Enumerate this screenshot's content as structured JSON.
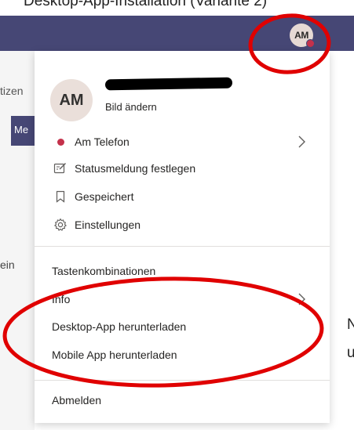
{
  "caption": {
    "top": "Desktop-App-Installation (Variante 2)"
  },
  "topbar": {
    "avatar_initials": "AM"
  },
  "background": {
    "left_fragment_1": "tizen",
    "left_fragment_2": "Me",
    "left_fragment_3": "ein",
    "right_fragment_1": "N",
    "right_fragment_2": "u"
  },
  "profile": {
    "initials": "AM",
    "change_picture": "Bild ändern"
  },
  "menu": {
    "status": "Am Telefon",
    "status_message": "Statusmeldung festlegen",
    "saved": "Gespeichert",
    "settings": "Einstellungen",
    "shortcuts": "Tastenkombinationen",
    "info": "Info",
    "desktop_app": "Desktop-App herunterladen",
    "mobile_app": "Mobile App herunterladen",
    "sign_out": "Abmelden"
  },
  "colors": {
    "header": "#464775",
    "status_busy": "#c4314b",
    "annotation": "#e00000"
  }
}
